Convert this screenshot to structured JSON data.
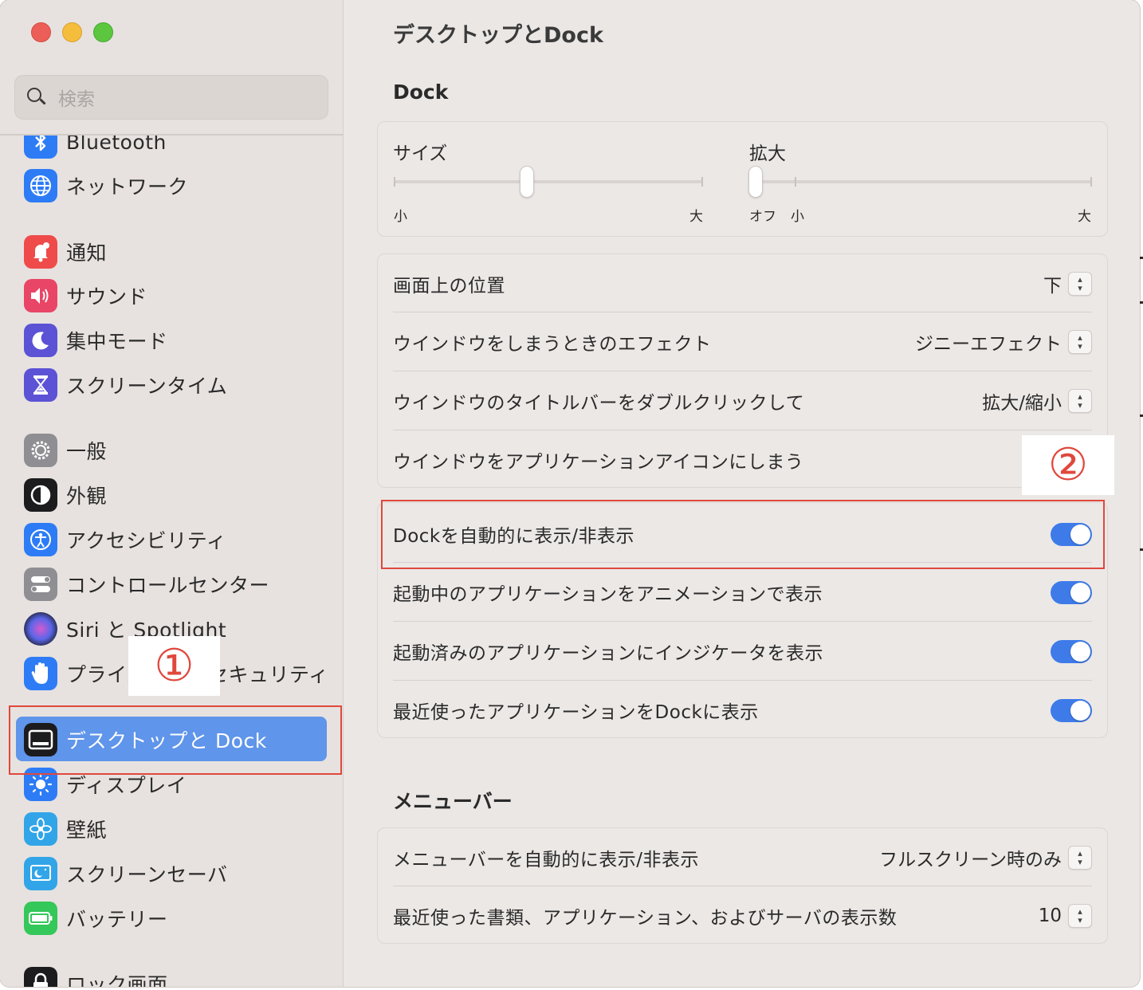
{
  "window": {
    "title": "デスクトップとDock",
    "traffic_lights": {
      "close_color": "#ec5f58",
      "minimize_color": "#f5bd3c",
      "zoom_color": "#5cc63f"
    }
  },
  "sidebar": {
    "search_placeholder": "検索",
    "items": [
      {
        "label": "Bluetooth",
        "icon": "bluetooth-icon",
        "color": "#2d7cf6"
      },
      {
        "label": "ネットワーク",
        "icon": "globe-icon",
        "color": "#2d7cf6"
      },
      {
        "label": "通知",
        "icon": "bell-icon",
        "color": "#ef4b4b"
      },
      {
        "label": "サウンド",
        "icon": "speaker-icon",
        "color": "#e94566"
      },
      {
        "label": "集中モード",
        "icon": "moon-icon",
        "color": "#5b52d6"
      },
      {
        "label": "スクリーンタイム",
        "icon": "hourglass-icon",
        "color": "#5b52d6"
      },
      {
        "label": "一般",
        "icon": "gear-icon",
        "color": "#8e8e93"
      },
      {
        "label": "外観",
        "icon": "appearance-icon",
        "color": "#1c1c1e"
      },
      {
        "label": "アクセシビリティ",
        "icon": "accessibility-icon",
        "color": "#2d7cf6"
      },
      {
        "label": "コントロールセンター",
        "icon": "control-center-icon",
        "color": "#8e8e93"
      },
      {
        "label": "Siri と Spotlight",
        "icon": "siri-icon",
        "color": "#2b2b55"
      },
      {
        "label": "プライバシーとセキュリティ",
        "icon": "hand-icon",
        "color": "#2d7cf6"
      },
      {
        "label": "デスクトップと Dock",
        "icon": "dock-icon",
        "color": "#1c1c1e"
      },
      {
        "label": "ディスプレイ",
        "icon": "sun-icon",
        "color": "#2d7cf6"
      },
      {
        "label": "壁紙",
        "icon": "flower-icon",
        "color": "#32a5e8"
      },
      {
        "label": "スクリーンセーバ",
        "icon": "screensaver-icon",
        "color": "#32a5e8"
      },
      {
        "label": "バッテリー",
        "icon": "battery-icon",
        "color": "#34c759"
      },
      {
        "label": "ロック画面",
        "icon": "lock-icon",
        "color": "#1c1c1e"
      }
    ],
    "selected_index": 12,
    "selected_color": "#5f95ea"
  },
  "annotations": {
    "marker_1": "①",
    "marker_2": "②",
    "color": "#e0483d"
  },
  "main": {
    "dock_section_title": "Dock",
    "size_slider": {
      "label": "サイズ",
      "min_label": "小",
      "max_label": "大",
      "value_fraction": 0.43
    },
    "magnification_slider": {
      "label": "拡大",
      "off_label": "オフ",
      "min_label": "小",
      "max_label": "大",
      "value_fraction": 0.0
    },
    "position": {
      "label": "画面上の位置",
      "value": "下"
    },
    "minimize_effect": {
      "label": "ウインドウをしまうときのエフェクト",
      "value": "ジニーエフェクト"
    },
    "titlebar_double_click": {
      "label": "ウインドウのタイトルバーをダブルクリックして",
      "value": "拡大/縮小"
    },
    "minimize_into_icon": {
      "label": "ウインドウをアプリケーションアイコンにしまう"
    },
    "auto_hide": {
      "label": "Dockを自動的に表示/非表示",
      "on": true
    },
    "animate_opening": {
      "label": "起動中のアプリケーションをアニメーションで表示",
      "on": true
    },
    "show_indicators": {
      "label": "起動済みのアプリケーションにインジケータを表示",
      "on": true
    },
    "show_recent": {
      "label": "最近使ったアプリケーションをDockに表示",
      "on": true
    },
    "menubar_section_title": "メニューバー",
    "menubar_auto_hide": {
      "label": "メニューバーを自動的に表示/非表示",
      "value": "フルスクリーン時のみ"
    },
    "recent_items": {
      "label": "最近使った書類、アプリケーション、およびサーバの表示数",
      "value": "10"
    },
    "accent_color": "#3e7be9"
  }
}
